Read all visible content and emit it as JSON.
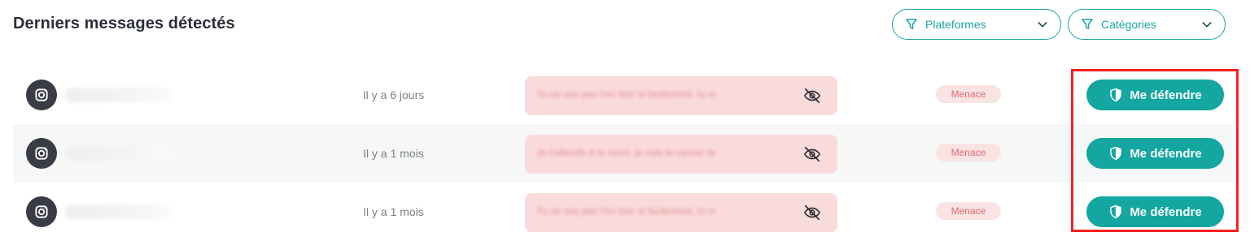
{
  "header": {
    "title": "Derniers messages détectés",
    "filters": [
      {
        "label": "Plateformes",
        "icon": "funnel-icon"
      },
      {
        "label": "Catégories",
        "icon": "funnel-icon"
      }
    ]
  },
  "messages": [
    {
      "platform_icon": "instagram-icon",
      "time": "Il y a 6 jours",
      "text": "Tu ne vas pas t'en tirer si facilement, tu vi",
      "category": "Menace",
      "action": "Me défendre"
    },
    {
      "platform_icon": "instagram-icon",
      "time": "Il y a 1 mois",
      "text": "Je t'attends à la récré, je vais te casser la",
      "category": "Menace",
      "action": "Me défendre"
    },
    {
      "platform_icon": "instagram-icon",
      "time": "Il y a 1 mois",
      "text": "Tu ne vas pas t'en tirer si facilement, tu vi",
      "category": "Menace",
      "action": "Me défendre"
    }
  ],
  "colors": {
    "accent": "#14a6a0",
    "danger_bg": "#fadbdc",
    "danger_text": "#e06b6f",
    "highlight": "#ff1f1f"
  }
}
